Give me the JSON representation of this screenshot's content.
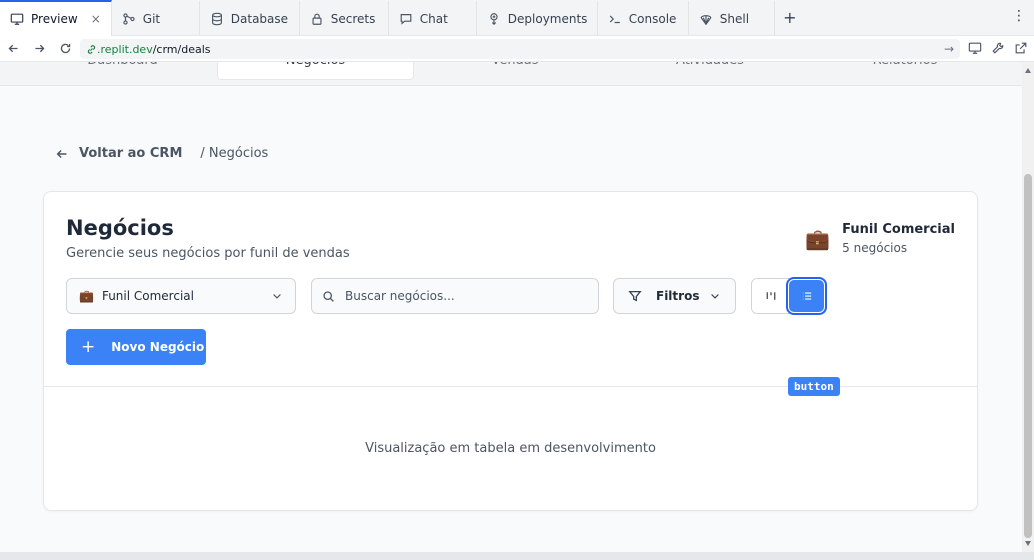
{
  "browser": {
    "tabs": [
      {
        "label": "Preview",
        "icon": "monitor-icon",
        "active": true,
        "closable": true
      },
      {
        "label": "Git",
        "icon": "git-icon"
      },
      {
        "label": "Database",
        "icon": "database-icon"
      },
      {
        "label": "Secrets",
        "icon": "lock-icon"
      },
      {
        "label": "Chat",
        "icon": "chat-icon"
      },
      {
        "label": "Deployments",
        "icon": "deployments-icon"
      },
      {
        "label": "Console",
        "icon": "terminal-icon"
      },
      {
        "label": "Shell",
        "icon": "shell-icon"
      }
    ],
    "close_glyph": "×",
    "add_tab_glyph": "+",
    "more_glyph": "⋮",
    "url_host": ".replit.dev",
    "url_path": "/crm/deals",
    "go_glyph": "→"
  },
  "app": {
    "subnav": [
      "Dashboard",
      "Negócios",
      "Vendas",
      "Atividades",
      "Relatórios"
    ],
    "subnav_active_index": 1,
    "breadcrumb": {
      "back_label": "Voltar ao CRM",
      "current": "/ Negócios"
    },
    "header": {
      "title": "Negócios",
      "subtitle": "Gerencie seus negócios por funil de vendas"
    },
    "pipeline_summary": {
      "icon_glyph": "💼",
      "name": "Funil Comercial",
      "count": "5 negócios"
    },
    "toolbar": {
      "pipeline_select": {
        "value": "Funil Comercial",
        "icon_glyph": "💼"
      },
      "search_placeholder": "Buscar negócios...",
      "filters_label": "Filtros",
      "view_mode": "list"
    },
    "new_button": {
      "label": "Novo Negócio",
      "icon_glyph": "+"
    },
    "tooltip": "button",
    "empty_message": "Visualização em tabela em desenvolvimento"
  },
  "colors": {
    "accent": "#3b82f6",
    "url_host": "#15803d"
  }
}
